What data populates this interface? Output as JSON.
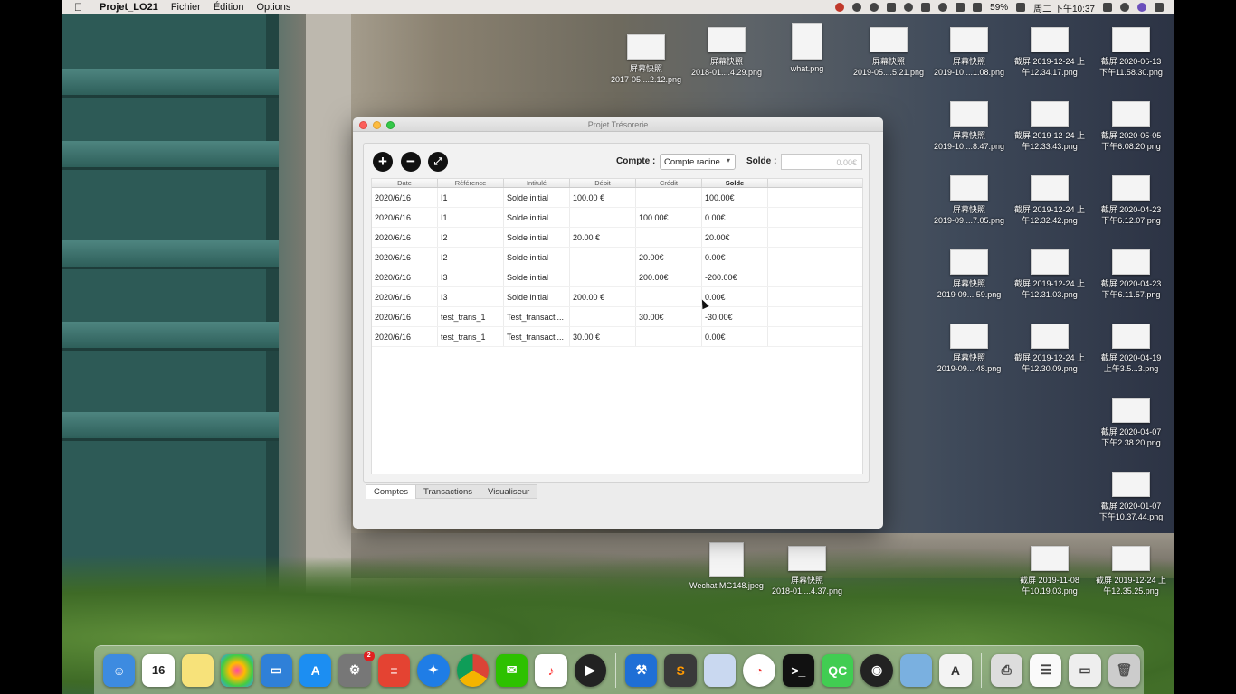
{
  "menubar": {
    "app_name": "Projet_LO21",
    "menus": [
      "Fichier",
      "Édition",
      "Options"
    ],
    "battery": "59%",
    "clock": "周二 下午10:37"
  },
  "desktop_icons": [
    {
      "label": "屏幕快照\n2017-05....2.12.png"
    },
    {
      "label": "屏幕快照\n2018-01....4.29.png"
    },
    {
      "label": "what.png"
    },
    {
      "label": "屏幕快照\n2019-05....5.21.png"
    },
    {
      "label": "屏幕快照\n2019-10....1.08.png"
    },
    {
      "label": "截屏 2019-12-24 上\n午12.34.17.png"
    },
    {
      "label": "截屏 2020-06-13\n下午11.58.30.png"
    },
    {
      "label": "屏幕快照\n2019-10....8.47.png"
    },
    {
      "label": "截屏 2019-12-24 上\n午12.33.43.png"
    },
    {
      "label": "截屏 2020-05-05\n下午6.08.20.png"
    },
    {
      "label": "屏幕快照\n2019-09....7.05.png"
    },
    {
      "label": "截屏 2019-12-24 上\n午12.32.42.png"
    },
    {
      "label": "截屏 2020-04-23\n下午6.12.07.png"
    },
    {
      "label": "屏幕快照\n2019-09....59.png"
    },
    {
      "label": "截屏 2019-12-24 上\n午12.31.03.png"
    },
    {
      "label": "截屏 2020-04-23\n下午6.11.57.png"
    },
    {
      "label": "屏幕快照\n2019-09....48.png"
    },
    {
      "label": "截屏 2019-12-24 上\n午12.30.09.png"
    },
    {
      "label": "截屏 2020-04-19\n上午3.5...3.png"
    },
    {
      "label": "截屏 2020-04-07\n下午2.38.20.png"
    },
    {
      "label": "截屏 2020-01-07\n下午10.37.44.png"
    },
    {
      "label": "WechatIMG148.jpeg"
    },
    {
      "label": "屏幕快照\n2018-01....4.37.png"
    },
    {
      "label": "截屏 2019-11-08\n午10.19.03.png"
    },
    {
      "label": "截屏 2019-12-24 上\n午12.35.25.png"
    }
  ],
  "window": {
    "title": "Projet Trésorerie",
    "toolbar": {
      "add_label": "+",
      "remove_label": "−",
      "edit_label": "⤢",
      "compte_label": "Compte :",
      "compte_value": "Compte racine",
      "solde_label": "Solde :",
      "solde_value": "0.00€"
    },
    "table": {
      "columns": [
        "Date",
        "Référence",
        "Intitulé",
        "Débit",
        "Crédit",
        "Solde"
      ],
      "rows": [
        [
          "2020/6/16",
          "I1",
          "Solde initial",
          "100.00 €",
          "",
          "100.00€"
        ],
        [
          "2020/6/16",
          "I1",
          "Solde initial",
          "",
          "100.00€",
          "0.00€"
        ],
        [
          "2020/6/16",
          "I2",
          "Solde initial",
          "20.00 €",
          "",
          "20.00€"
        ],
        [
          "2020/6/16",
          "I2",
          "Solde initial",
          "",
          "20.00€",
          "0.00€"
        ],
        [
          "2020/6/16",
          "I3",
          "Solde initial",
          "",
          "200.00€",
          "-200.00€"
        ],
        [
          "2020/6/16",
          "I3",
          "Solde initial",
          "200.00 €",
          "",
          "0.00€"
        ],
        [
          "2020/6/16",
          "test_trans_1",
          "Test_transacti...",
          "",
          "30.00€",
          "-30.00€"
        ],
        [
          "2020/6/16",
          "test_trans_1",
          "Test_transacti...",
          "30.00 €",
          "",
          "0.00€"
        ]
      ]
    },
    "tabs": [
      "Comptes",
      "Transactions",
      "Visualiseur"
    ],
    "active_tab": "Comptes"
  },
  "dock": {
    "calendar_day": "16",
    "settings_badge": "2",
    "items": [
      "finder-icon",
      "calendar-icon",
      "notes-icon",
      "photos-icon",
      "keynote-icon",
      "app-store-icon",
      "system-preferences-icon",
      "todoist-icon",
      "safari-icon",
      "chrome-icon",
      "wechat-icon",
      "music-icon",
      "quicktime-icon",
      "xcode-icon",
      "sublime-icon",
      "preview-icon",
      "activity-icon",
      "terminal-icon",
      "qt-creator-icon",
      "obs-icon",
      "image-capture-icon",
      "textedit-icon",
      "printer-icon",
      "document-icon",
      "screen-icon",
      "trash-icon"
    ]
  }
}
